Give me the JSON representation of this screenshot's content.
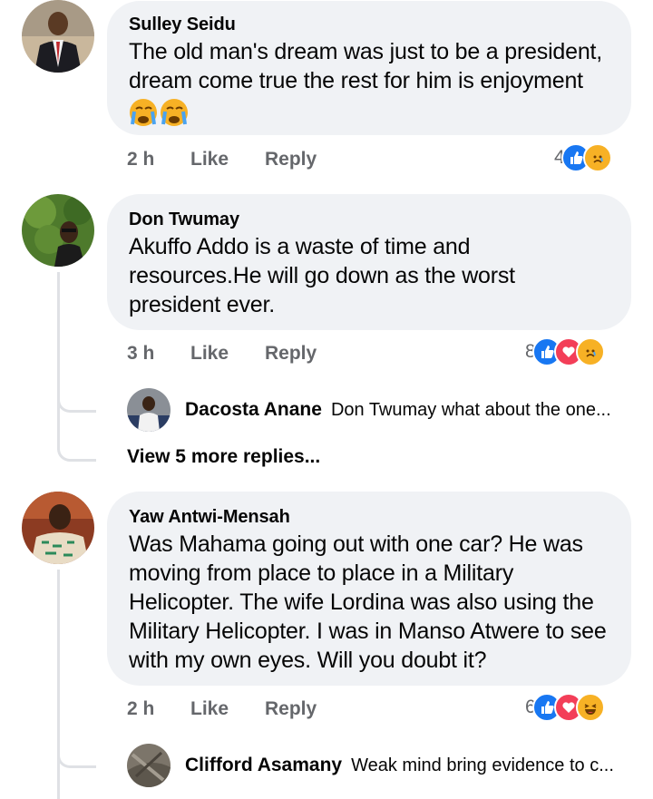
{
  "comments": [
    {
      "author": "Sulley Seidu",
      "text": "The old man's dream was just to be a president, dream come true the rest for him is enjoyment",
      "emojis": [
        "crying-face",
        "crying-face"
      ],
      "time": "2 h",
      "like_label": "Like",
      "reply_label": "Reply",
      "reaction_count": "4",
      "reactions": [
        "like",
        "sad"
      ]
    },
    {
      "author": "Don Twumay",
      "text": "Akuffo Addo is a waste of time and resources.He will go down as the worst president ever.",
      "time": "3 h",
      "like_label": "Like",
      "reply_label": "Reply",
      "reaction_count": "8",
      "reactions": [
        "like",
        "love",
        "sad"
      ],
      "reply_preview": {
        "author": "Dacosta Anane",
        "text": "Don Twumay what about the one..."
      },
      "more_replies": "View 5 more replies..."
    },
    {
      "author": "Yaw Antwi-Mensah",
      "text": "Was Mahama going out with one car? He was moving from place to place in a Military Helicopter. The wife Lordina was also using the Military Helicopter. I was in Manso Atwere to see with my own eyes. Will you doubt it?",
      "time": "2 h",
      "like_label": "Like",
      "reply_label": "Reply",
      "reaction_count": "6",
      "reactions": [
        "like",
        "love",
        "haha"
      ],
      "reply_preview": {
        "author": "Clifford Asamany",
        "text": "Weak mind bring evidence to c..."
      }
    }
  ],
  "colors": {
    "bubble": "#f0f2f5",
    "meta": "#65676b",
    "like": "#1877f2",
    "love": "#f33e58",
    "emoji": "#f7b125"
  }
}
